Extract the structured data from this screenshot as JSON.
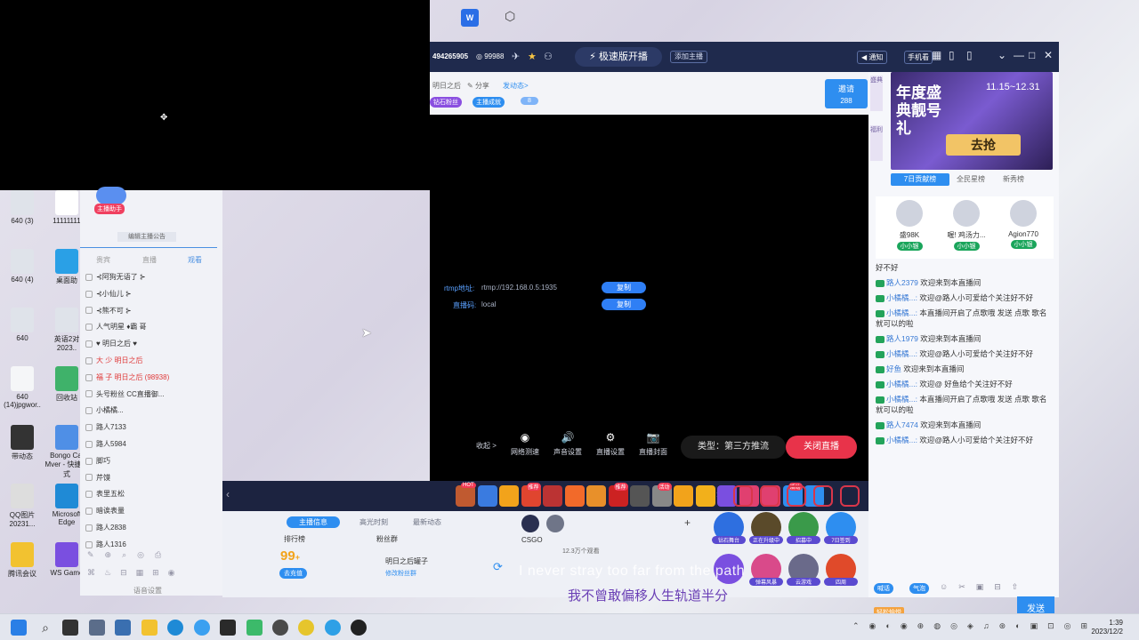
{
  "desktop": {
    "icons": [
      {
        "label": "640 (3)"
      },
      {
        "label": "11111111"
      },
      {
        "label": "640 (4)"
      },
      {
        "label": "桌面助"
      },
      {
        "label": "640"
      },
      {
        "label": "英语2对2023.."
      },
      {
        "label": "640 (14)jpgwor.."
      },
      {
        "label": "回收站"
      },
      {
        "label": "带动态"
      },
      {
        "label": "Bongo Cat Mver - 快捷方式"
      },
      {
        "label": "QQ图片20231..."
      },
      {
        "label": "Microsoft Edge"
      },
      {
        "label": "腾讯会议"
      },
      {
        "label": "WS Game"
      }
    ]
  },
  "app": {
    "room_id": "494265905",
    "fans_count": "99988",
    "fast_button": "极速版开播",
    "add_anchor": "添加主播",
    "notice": "通知",
    "phone": "手机看",
    "crumbs": [
      "明日之后",
      "分享",
      "发动态>"
    ],
    "tags": [
      "钻石粉丝",
      "主播成就",
      "8"
    ],
    "invite": {
      "label": "邀请",
      "count": "288"
    },
    "rtmp": {
      "addr_label": "rtmp地址:",
      "addr_value": "rtmp://192.168.0.5:1935",
      "key_label": "直播码:",
      "key_value": "local",
      "copy": "复制"
    },
    "collapse": "收起 >",
    "controls": [
      {
        "icon": "◉",
        "label": "网络测速"
      },
      {
        "icon": "🔊",
        "label": "声音设置"
      },
      {
        "icon": "⚙",
        "label": "直播设置"
      },
      {
        "icon": "📷",
        "label": "直播封面"
      }
    ],
    "stream_type": "类型：第三方推流",
    "close_live": "关闭直播",
    "gift_badges": [
      "HOT",
      "推荐",
      "推荐",
      "活动",
      "活动",
      "活动",
      "活动"
    ],
    "bottom_tabs": [
      "主播信息",
      "高光时刻",
      "最新动态"
    ],
    "rank_label": "排行榜",
    "fans_label": "粉丝群",
    "score": "99",
    "score_unit": "+",
    "score_sub": "去充值",
    "fan_group": "明日之后罐子",
    "fan_group_edit": "修改粉丝群",
    "game": "CSGO",
    "viewers": "12.3万个观看",
    "activity_labels": [
      "钻石舞台",
      "正在升级中",
      "招募中",
      "7日签到"
    ],
    "activity_labels2": [
      "",
      "弹幕风暴",
      "云游戏",
      "四周"
    ]
  },
  "sidebar": {
    "banner": {
      "title": "年度盛典靓号礼",
      "date": "11.15~12.31",
      "cta": "去抢"
    },
    "rank_tabs": [
      "7日贡献榜",
      "全民星榜",
      "新秀榜"
    ],
    "top3": [
      {
        "name": "盛98K",
        "badge": "小小银"
      },
      {
        "name": "喔! 鸡汤力...",
        "badge": "小小银"
      },
      {
        "name": "Agion770",
        "badge": "小小银"
      }
    ],
    "chat": [
      {
        "user": "",
        "text": "好不好"
      },
      {
        "user": "路人2379",
        "text": "欢迎来到本直播间"
      },
      {
        "user": "小橘橘...:",
        "text": "欢迎@路人小可爱给个关注好不好"
      },
      {
        "user": "小橘橘...:",
        "text": "本直播间开启了点歌哦 发送 点歌 歌名 就可以的啦"
      },
      {
        "user": "路人1979",
        "text": "欢迎来到本直播间"
      },
      {
        "user": "小橘橘...:",
        "text": "欢迎@路人小可爱给个关注好不好"
      },
      {
        "user": "好鱼",
        "text": "欢迎来到本直播间"
      },
      {
        "user": "小橘橘...:",
        "text": "欢迎@ 好鱼给个关注好不好"
      },
      {
        "user": "小橘橘...:",
        "text": "本直播间开启了点歌哦 发送 点歌 歌名 就可以的啦"
      },
      {
        "user": "路人7474",
        "text": "欢迎来到本直播间"
      },
      {
        "user": "小橘橘...:",
        "text": "欢迎@路人小可爱给个关注好不好"
      }
    ],
    "chat_tools": [
      "喊话",
      "气泡"
    ],
    "input_placeholder": "轻松愉悦",
    "send": "发送"
  },
  "leftpanel": {
    "assistant": "主播助手",
    "edit_notice": "编辑主播公告",
    "tabs": [
      "贵宾",
      "直播",
      "观看"
    ],
    "items": [
      "⊰阿狗无语了 ⊱",
      "⊰小仙儿 ⊱",
      "⊰熊不可 ⊱",
      "人气明星 ♦霸 哥",
      "♥ 明日之后 ♥",
      "大 少 明日之后",
      "福 子 明日之后 (98938)",
      "头号粉丝 CC直播御...",
      "小橘橘...",
      "路人7133",
      "路人5984",
      "脚巧",
      "芹馍",
      "表里五松",
      "暗诶表量",
      "路人2838",
      "路人1316"
    ],
    "footer": "语音设置"
  },
  "subtitle": {
    "en": "I never stray too far from the path",
    "zh": "我不曾敢偏移人生轨道半分"
  },
  "taskbar": {
    "time": "1:39",
    "date": "2023/12/2"
  }
}
